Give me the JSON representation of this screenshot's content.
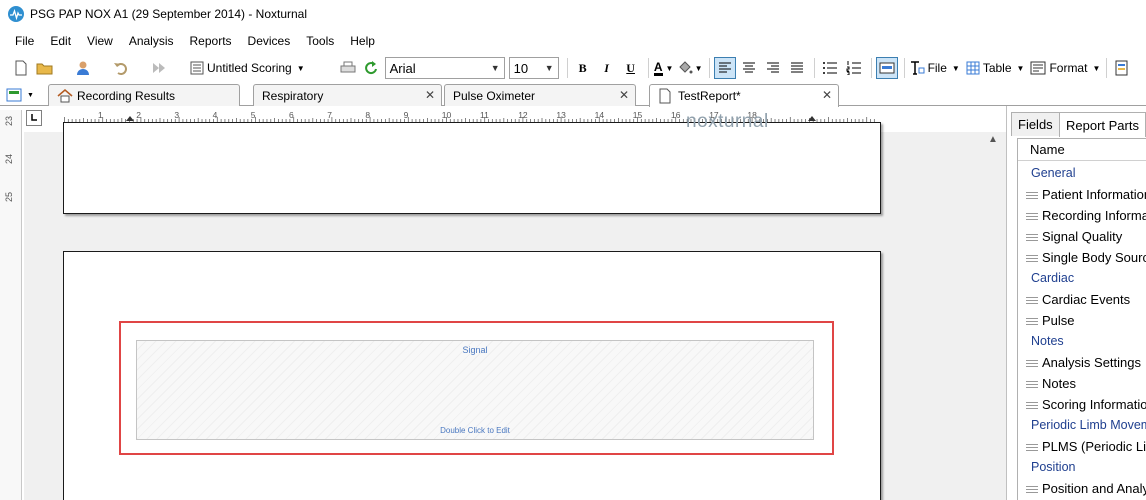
{
  "window": {
    "title": "PSG PAP NOX A1 (29 September 2014)  - Noxturnal"
  },
  "menu": [
    "File",
    "Edit",
    "View",
    "Analysis",
    "Reports",
    "Devices",
    "Tools",
    "Help"
  ],
  "toolbar": {
    "scoring_label": "Untitled Scoring",
    "font_name": "Arial",
    "font_size": "10",
    "bold": "B",
    "italic": "I",
    "underline": "U",
    "font_color_glyph": "A",
    "file_label": "File",
    "table_label": "Table",
    "format_label": "Format"
  },
  "tabs": [
    {
      "label": "Recording Results"
    },
    {
      "label": "Respiratory"
    },
    {
      "label": "Pulse Oximeter"
    },
    {
      "label": "TestReport*"
    }
  ],
  "ruler": {
    "h_labels": [
      "1",
      "2",
      "3",
      "4",
      "5",
      "6",
      "7",
      "8",
      "9",
      "10",
      "11",
      "12",
      "13",
      "14",
      "15",
      "16",
      "17",
      "18"
    ],
    "v_labels": [
      "23",
      "24",
      "25"
    ]
  },
  "report": {
    "watermark": "noxturnal",
    "signal_title": "Signal",
    "signal_hint": "Double Click to Edit"
  },
  "right_panel": {
    "tabs": [
      "Fields",
      "Report Parts"
    ],
    "column_header": "Name",
    "tree": [
      {
        "type": "cat",
        "label": "General"
      },
      {
        "type": "item",
        "label": "Patient Information"
      },
      {
        "type": "item",
        "label": "Recording Information"
      },
      {
        "type": "item",
        "label": "Signal Quality"
      },
      {
        "type": "item",
        "label": "Single Body Source"
      },
      {
        "type": "cat",
        "label": "Cardiac"
      },
      {
        "type": "item",
        "label": "Cardiac Events"
      },
      {
        "type": "item",
        "label": "Pulse"
      },
      {
        "type": "cat",
        "label": "Notes"
      },
      {
        "type": "item",
        "label": "Analysis Settings"
      },
      {
        "type": "item",
        "label": "Notes"
      },
      {
        "type": "item",
        "label": "Scoring Information"
      },
      {
        "type": "cat",
        "label": "Periodic Limb Movements"
      },
      {
        "type": "item",
        "label": "PLMS (Periodic Limb"
      },
      {
        "type": "cat",
        "label": "Position"
      },
      {
        "type": "item",
        "label": "Position and Analysis"
      }
    ]
  }
}
